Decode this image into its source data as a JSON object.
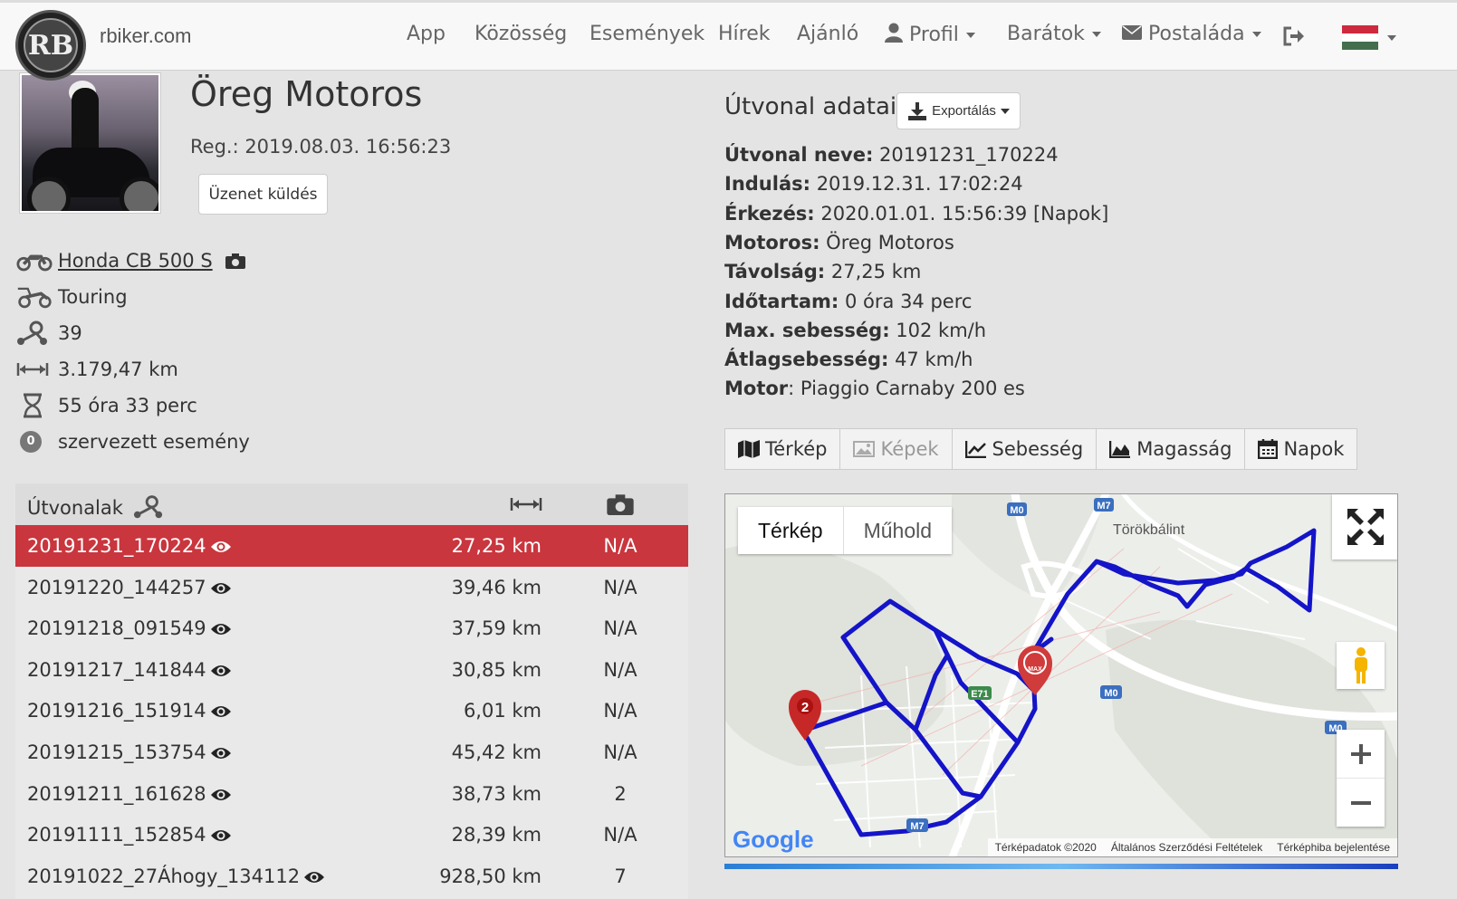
{
  "brand": "rbiker.com",
  "logo_text": "RB",
  "nav": {
    "items": [
      "App",
      "Közösség",
      "Események",
      "Hírek",
      "Ajánló"
    ],
    "profile": "Profil",
    "friends": "Barátok",
    "mailbox": "Postaláda"
  },
  "profile": {
    "name": "Öreg Motoros",
    "reg": "Reg.: 2019.08.03. 16:56:23",
    "message_button": "Üzenet küldés",
    "bike": "Honda CB 500 S",
    "style": "Touring",
    "routes_count": "39",
    "distance": "3.179,47 km",
    "duration": "55 óra 33 perc",
    "events_badge": "0",
    "events_label": "szervezett esemény"
  },
  "routes_table": {
    "header": "Útvonalak",
    "rows": [
      {
        "name": "20191231_170224",
        "km": "27,25 km",
        "photos": "N/A"
      },
      {
        "name": "20191220_144257",
        "km": "39,46 km",
        "photos": "N/A"
      },
      {
        "name": "20191218_091549",
        "km": "37,59 km",
        "photos": "N/A"
      },
      {
        "name": "20191217_141844",
        "km": "30,85 km",
        "photos": "N/A"
      },
      {
        "name": "20191216_151914",
        "km": "6,01 km",
        "photos": "N/A"
      },
      {
        "name": "20191215_153754",
        "km": "45,42 km",
        "photos": "N/A"
      },
      {
        "name": "20191211_161628",
        "km": "38,73 km",
        "photos": "2"
      },
      {
        "name": "20191111_152854",
        "km": "28,39 km",
        "photos": "N/A"
      },
      {
        "name": "20191022_27Áhogy_134112",
        "km": "928,50 km",
        "photos": "7"
      }
    ]
  },
  "route_details": {
    "title": "Útvonal adatai",
    "export_button": "Exportálás",
    "fields": [
      {
        "label": "Útvonal neve:",
        "value": " 20191231_170224"
      },
      {
        "label": "Indulás:",
        "value": " 2019.12.31. 17:02:24"
      },
      {
        "label": "Érkezés:",
        "value": " 2020.01.01. 15:56:39 [Napok]"
      },
      {
        "label": "Motoros:",
        "value": " Öreg Motoros"
      },
      {
        "label": "Távolság:",
        "value": " 27,25 km"
      },
      {
        "label": "Időtartam:",
        "value": " 0 óra 34 perc"
      },
      {
        "label": "Max. sebesség:",
        "value": " 102 km/h"
      },
      {
        "label": "Átlagsebesség:",
        "value": " 47 km/h"
      },
      {
        "label": "Motor",
        "value": ": Piaggio Carnaby 200 es"
      }
    ]
  },
  "tabs": [
    "Térkép",
    "Képek",
    "Sebesség",
    "Magasság",
    "Napok"
  ],
  "map": {
    "type_map": "Térkép",
    "type_satellite": "Műhold",
    "place": "Törökbálint",
    "marker_label": "2",
    "max_label": "MAX",
    "road_labels": [
      "M0",
      "M7",
      "E71",
      "M0",
      "M0",
      "M7"
    ],
    "google": "Google",
    "attribution": [
      "Térképadatok ©2020",
      "Általános Szerződési Feltételek",
      "Térképhiba bejelentése"
    ]
  }
}
